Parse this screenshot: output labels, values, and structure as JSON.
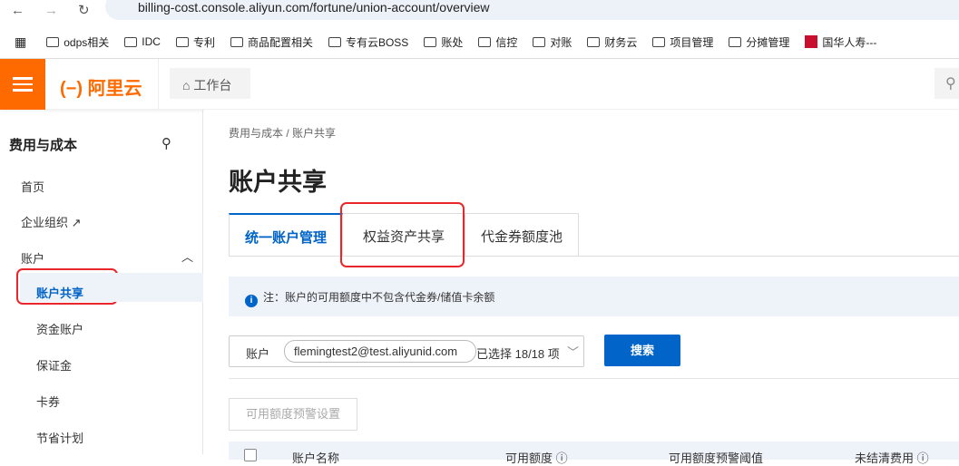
{
  "browser": {
    "url": "billing-cost.console.aliyun.com/fortune/union-account/overview",
    "bookmarks": [
      "odps相关",
      "IDC",
      "专利",
      "商品配置相关",
      "专有云BOSS",
      "账处",
      "信控",
      "对账",
      "财务云",
      "项目管理",
      "分摊管理",
      "国华人寿---"
    ]
  },
  "topbar": {
    "logo": "阿里云",
    "workbench": "工作台"
  },
  "sidebar": {
    "title": "费用与成本",
    "items": [
      {
        "label": "首页"
      },
      {
        "label": "企业组织 ↗"
      },
      {
        "label": "账户"
      },
      {
        "label": "账户共享"
      },
      {
        "label": "资金账户"
      },
      {
        "label": "保证金"
      },
      {
        "label": "卡券"
      },
      {
        "label": "节省计划"
      }
    ]
  },
  "main": {
    "breadcrumb": "费用与成本  /  账户共享",
    "title": "账户共享",
    "tabs": [
      {
        "label": "统一账户管理"
      },
      {
        "label": "权益资产共享"
      },
      {
        "label": "代金券额度池"
      }
    ],
    "note": "注：账户的可用额度中不包含代金券/储值卡余额",
    "filter": {
      "label": "账户",
      "tag": "flemingtest2@test.aliyunid.com",
      "selected": "已选择 18/18 项"
    },
    "search_button": "搜索",
    "alert_button": "可用额度预警设置",
    "columns": [
      "账户名称",
      "可用额度 ⓘ",
      "可用额度预警阈值",
      "未结清费用 ⓘ"
    ]
  },
  "colors": {
    "accent": "#0064c8",
    "brand": "#ff6a00",
    "highlight": "#e8262c"
  }
}
